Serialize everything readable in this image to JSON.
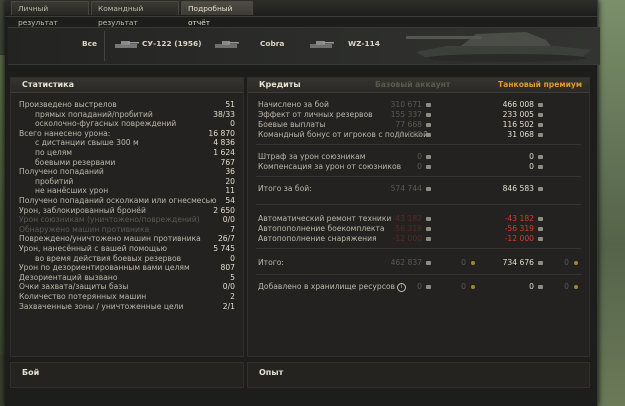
{
  "tabs": [
    {
      "label": "Личный результат"
    },
    {
      "label": "Командный результат"
    },
    {
      "label": "Подробный отчёт"
    }
  ],
  "banner": {
    "all_label": "Все",
    "tank1": "СУ-122 (1956)",
    "tank2": "Cobra",
    "tank3": "WZ-114"
  },
  "stats": {
    "title": "Статистика",
    "rows": [
      {
        "label": "Произведено выстрелов",
        "value": "51"
      },
      {
        "label": "прямых попаданий/пробитий",
        "value": "38/33"
      },
      {
        "label": "осколочно-фугасных повреждений",
        "value": "0"
      },
      {
        "label": "Всего нанесено урона:",
        "value": "16 870"
      },
      {
        "label": "с дистанции свыше 300 м",
        "value": "4 836"
      },
      {
        "label": "по целям",
        "value": "1 624"
      },
      {
        "label": "боевыми резервами",
        "value": "767"
      },
      {
        "label": "Получено попаданий",
        "value": "36"
      },
      {
        "label": "пробитий",
        "value": "20"
      },
      {
        "label": "не нанёсших урон",
        "value": "11"
      },
      {
        "label": "Получено попаданий осколками или огнесмесью",
        "value": "54"
      },
      {
        "label": "Урон, заблокированный бронёй",
        "value": "2 650"
      },
      {
        "label": "Урон союзникам (уничтожено/повреждений)",
        "value": "0/0"
      },
      {
        "label": "Обнаружено машин противника",
        "value": "7"
      },
      {
        "label": "Повреждено/уничтожено машин противника",
        "value": "26/7"
      },
      {
        "label": "Урон, нанесённый с вашей помощью",
        "value": "5 745"
      },
      {
        "label": "во время действия боевых резервов",
        "value": "0"
      },
      {
        "label": "Урон по дезориентированным вами целям",
        "value": "807"
      },
      {
        "label": "Дезориентаций вызвано",
        "value": "5"
      },
      {
        "label": "Очки захвата/защиты базы",
        "value": "0/0"
      },
      {
        "label": "Количество потерянных машин",
        "value": "2"
      },
      {
        "label": "Захваченные зоны / уничтоженные цели",
        "value": "2/1"
      }
    ]
  },
  "credits": {
    "title": "Кредиты",
    "col_base": "Базовый аккаунт",
    "col_prem": "Танковый премиум",
    "rows": [
      {
        "label": "Начислено за бой",
        "base": "310 671",
        "prem": "466 008"
      },
      {
        "label": "Эффект от личных резервов",
        "base": "155 337",
        "prem": "233 005"
      },
      {
        "label": "Боевые выплаты",
        "base": "77 668",
        "prem": "116 502"
      },
      {
        "label": "Командный бонус от игроков с подпиской",
        "base": "31 068",
        "prem": "31 068"
      },
      {
        "label": "Штраф за урон союзникам",
        "base": "0",
        "prem": "0"
      },
      {
        "label": "Компенсация за урон от союзников",
        "base": "0",
        "prem": "0"
      },
      {
        "label": "Итого за бой:",
        "base": "574 744",
        "prem": "846 583"
      },
      {
        "label": "Автоматический ремонт техники",
        "base": "-43 182",
        "prem": "-43 182"
      },
      {
        "label": "Автопополнение боекомплекта",
        "base": "-56 319",
        "prem": "-56 319"
      },
      {
        "label": "Автопополнение снаряжения",
        "base": "-12 000",
        "prem": "-12 000"
      },
      {
        "label": "Итого:",
        "base": "462 837",
        "base_gold": "0",
        "prem": "734 676",
        "prem_gold": "0"
      },
      {
        "label": "Добавлено в хранилище ресурсов",
        "base": "0",
        "base_gold": "0",
        "prem": "0",
        "prem_gold": "0"
      }
    ]
  },
  "bottom": {
    "left_title": "Бой",
    "right_title": "Опыт"
  }
}
